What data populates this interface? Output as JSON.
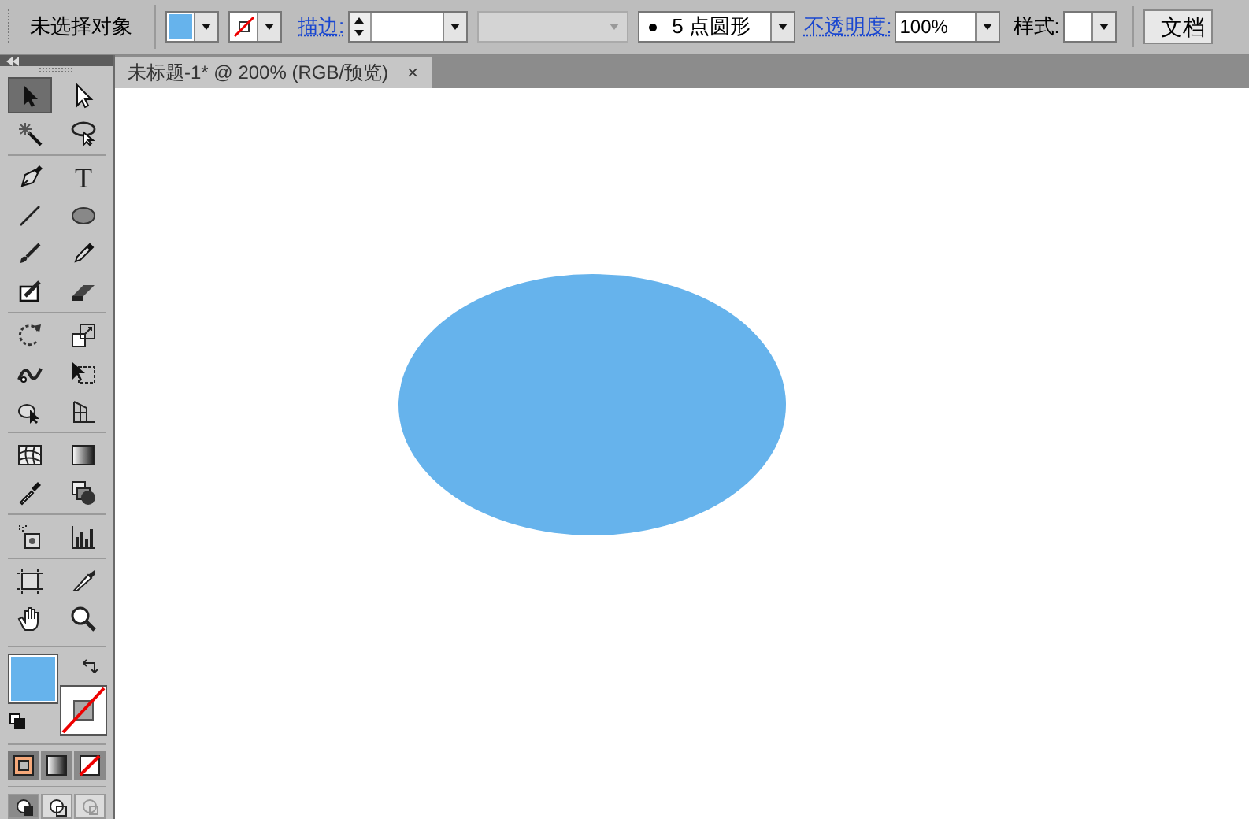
{
  "control_bar": {
    "selection_status": "未选择对象",
    "stroke_label": "描边:",
    "profile": "5 点圆形",
    "opacity_label": "不透明度:",
    "opacity": "100%",
    "style_label": "样式:",
    "document_button": "文档"
  },
  "document_tabs": [
    {
      "title": "未标题-1* @ 200% (RGB/预览)",
      "close": "×",
      "selected": true
    }
  ],
  "tool_groups": [
    [
      [
        {
          "kind": "selection",
          "selected": true
        },
        {
          "kind": "direct-selection",
          "selected": false
        }
      ],
      [
        {
          "kind": "magic-wand",
          "selected": false
        },
        {
          "kind": "lasso",
          "selected": false
        }
      ]
    ],
    [
      [
        {
          "kind": "pen",
          "selected": false
        },
        {
          "kind": "type",
          "glyph": "T",
          "selected": false
        }
      ],
      [
        {
          "kind": "line",
          "selected": false
        },
        {
          "kind": "ellipse",
          "selected": false
        }
      ],
      [
        {
          "kind": "brush",
          "selected": false
        },
        {
          "kind": "pencil",
          "selected": false
        }
      ],
      [
        {
          "kind": "blob",
          "selected": false
        },
        {
          "kind": "eraser",
          "selected": false
        }
      ]
    ],
    [
      [
        {
          "kind": "rotate",
          "selected": false
        },
        {
          "kind": "scale",
          "selected": false
        }
      ],
      [
        {
          "kind": "warp",
          "selected": false
        },
        {
          "kind": "free-transform",
          "selected": false
        }
      ],
      [
        {
          "kind": "shape-builder",
          "selected": false
        },
        {
          "kind": "perspective",
          "selected": false
        }
      ]
    ],
    [
      [
        {
          "kind": "mesh",
          "selected": false
        },
        {
          "kind": "gradient",
          "selected": false
        }
      ],
      [
        {
          "kind": "eyedropper",
          "selected": false
        },
        {
          "kind": "blend",
          "selected": false
        }
      ]
    ],
    [
      [
        {
          "kind": "spray",
          "selected": false
        },
        {
          "kind": "graph",
          "selected": false
        }
      ]
    ],
    [
      [
        {
          "kind": "artboard",
          "selected": false
        },
        {
          "kind": "slice",
          "selected": false
        }
      ],
      [
        {
          "kind": "hand",
          "selected": false
        },
        {
          "kind": "zoom",
          "selected": false
        }
      ]
    ]
  ],
  "draw_modes": [
    {
      "kind": "color",
      "selected": true
    },
    {
      "kind": "gradient",
      "selected": false
    },
    {
      "kind": "none",
      "selected": false
    }
  ],
  "screen_modes": [
    {
      "kind": "normal",
      "selected": true
    },
    {
      "kind": "behind",
      "selected": false
    },
    {
      "kind": "inside",
      "selected": false
    }
  ]
}
